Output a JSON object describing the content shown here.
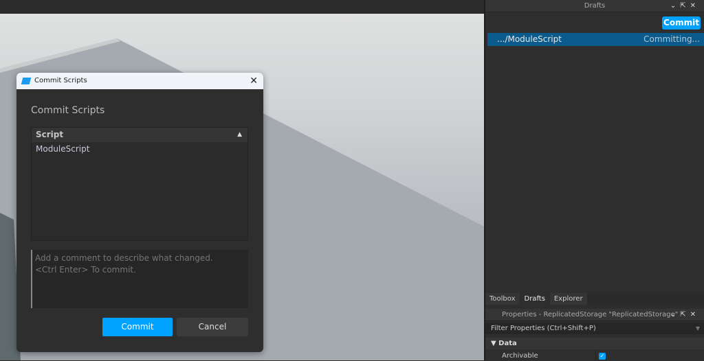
{
  "drafts_panel": {
    "title": "Drafts",
    "commit_label": "Commit",
    "items": [
      {
        "name": ".../ModuleScript",
        "status": "Committing..."
      }
    ],
    "tabs": [
      "Toolbox",
      "Drafts",
      "Explorer"
    ]
  },
  "properties_panel": {
    "title": "Properties - ReplicatedStorage \"ReplicatedStorage\"",
    "filter_placeholder": "Filter Properties (Ctrl+Shift+P)",
    "section": "Data",
    "props": [
      {
        "name": "Archivable",
        "checked": true
      }
    ]
  },
  "panel_controls": {
    "collapse": "⌄",
    "undock": "⇱",
    "close": "✕"
  },
  "dialog": {
    "window_title": "Commit Scripts",
    "heading": "Commit Scripts",
    "column": "Script",
    "scripts": [
      "ModuleScript"
    ],
    "comment_placeholder": "Add a comment to describe what changed.\n<Ctrl Enter> To commit.",
    "commit_label": "Commit",
    "cancel_label": "Cancel",
    "close": "✕"
  },
  "colors": {
    "accent": "#00a2ff",
    "selection": "#0b5a8c"
  }
}
